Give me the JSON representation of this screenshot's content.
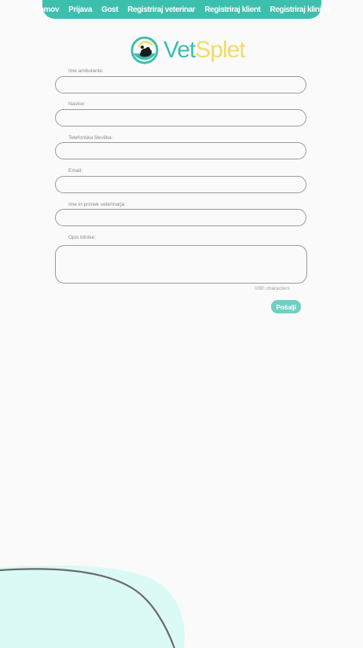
{
  "nav": {
    "items": [
      {
        "label": "Domov"
      },
      {
        "label": "Prijava"
      },
      {
        "label": "Gost"
      },
      {
        "label": "Registriraj veterinar"
      },
      {
        "label": "Registriraj klient"
      },
      {
        "label": "Registriraj kliniko"
      }
    ]
  },
  "logo": {
    "part1": "Vet",
    "part2": "Splet"
  },
  "form": {
    "fields": [
      {
        "label": "Ime ambulante:",
        "value": ""
      },
      {
        "label": "Naslov:",
        "value": ""
      },
      {
        "label": "Telefonska številka:",
        "value": ""
      },
      {
        "label": "Email:",
        "value": ""
      },
      {
        "label": "Ime in primek veterinarja:",
        "value": ""
      },
      {
        "label": "Opis klinike:",
        "value": ""
      }
    ],
    "counter": "0/90 characters",
    "submit_label": "Pošalji"
  },
  "colors": {
    "primary": "#3dbfae",
    "accent_yellow": "#f0dc6a",
    "blob": "#dcfaf5"
  }
}
